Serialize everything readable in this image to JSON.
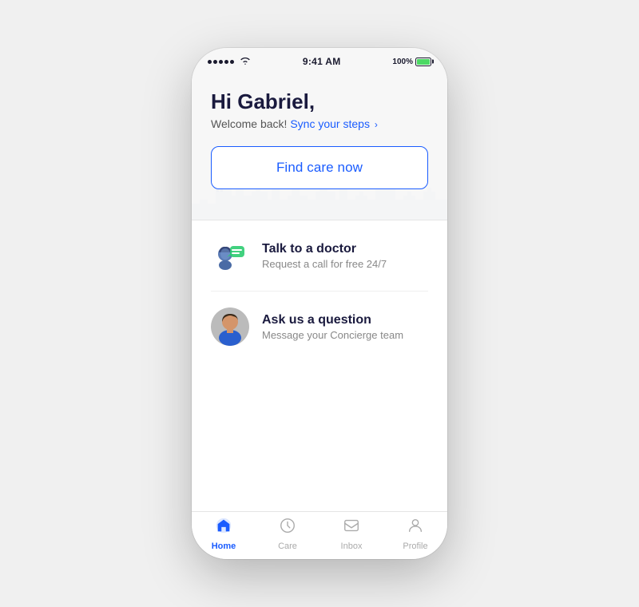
{
  "statusBar": {
    "time": "9:41 AM",
    "batteryPercent": "100%"
  },
  "hero": {
    "greeting": "Hi Gabriel,",
    "welcomeText": "Welcome back!",
    "syncText": "Sync your steps",
    "findCareBtn": "Find care now"
  },
  "cards": [
    {
      "id": "doctor",
      "title": "Talk to a doctor",
      "subtitle": "Request a call for free 24/7"
    },
    {
      "id": "question",
      "title": "Ask us a question",
      "subtitle": "Message your Concierge team"
    }
  ],
  "bottomNav": [
    {
      "id": "home",
      "label": "Home",
      "active": true
    },
    {
      "id": "care",
      "label": "Care",
      "active": false
    },
    {
      "id": "inbox",
      "label": "Inbox",
      "active": false
    },
    {
      "id": "profile",
      "label": "Profile",
      "active": false
    }
  ]
}
